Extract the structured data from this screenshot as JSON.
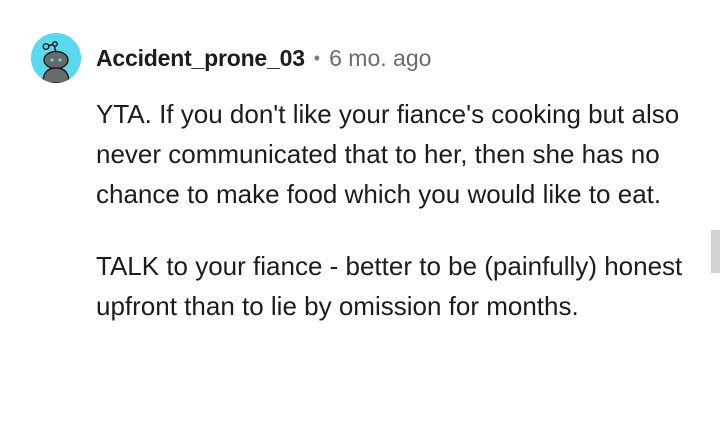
{
  "comment": {
    "author": "Accident_prone_03",
    "separator": "•",
    "timestamp": "6 mo. ago",
    "avatar_icon": "snoo-avatar-icon",
    "paragraphs": [
      "YTA. If you don't like your fiance's cooking but also never communicated that to her, then she has no chance to make food which you would like to eat.",
      "TALK to your fiance - better to be (painfully) honest upfront than to lie by omission for months."
    ]
  },
  "colors": {
    "avatar_bg": "#5ad9ee",
    "text": "#1c1c1c",
    "meta": "#6b6b6b"
  }
}
